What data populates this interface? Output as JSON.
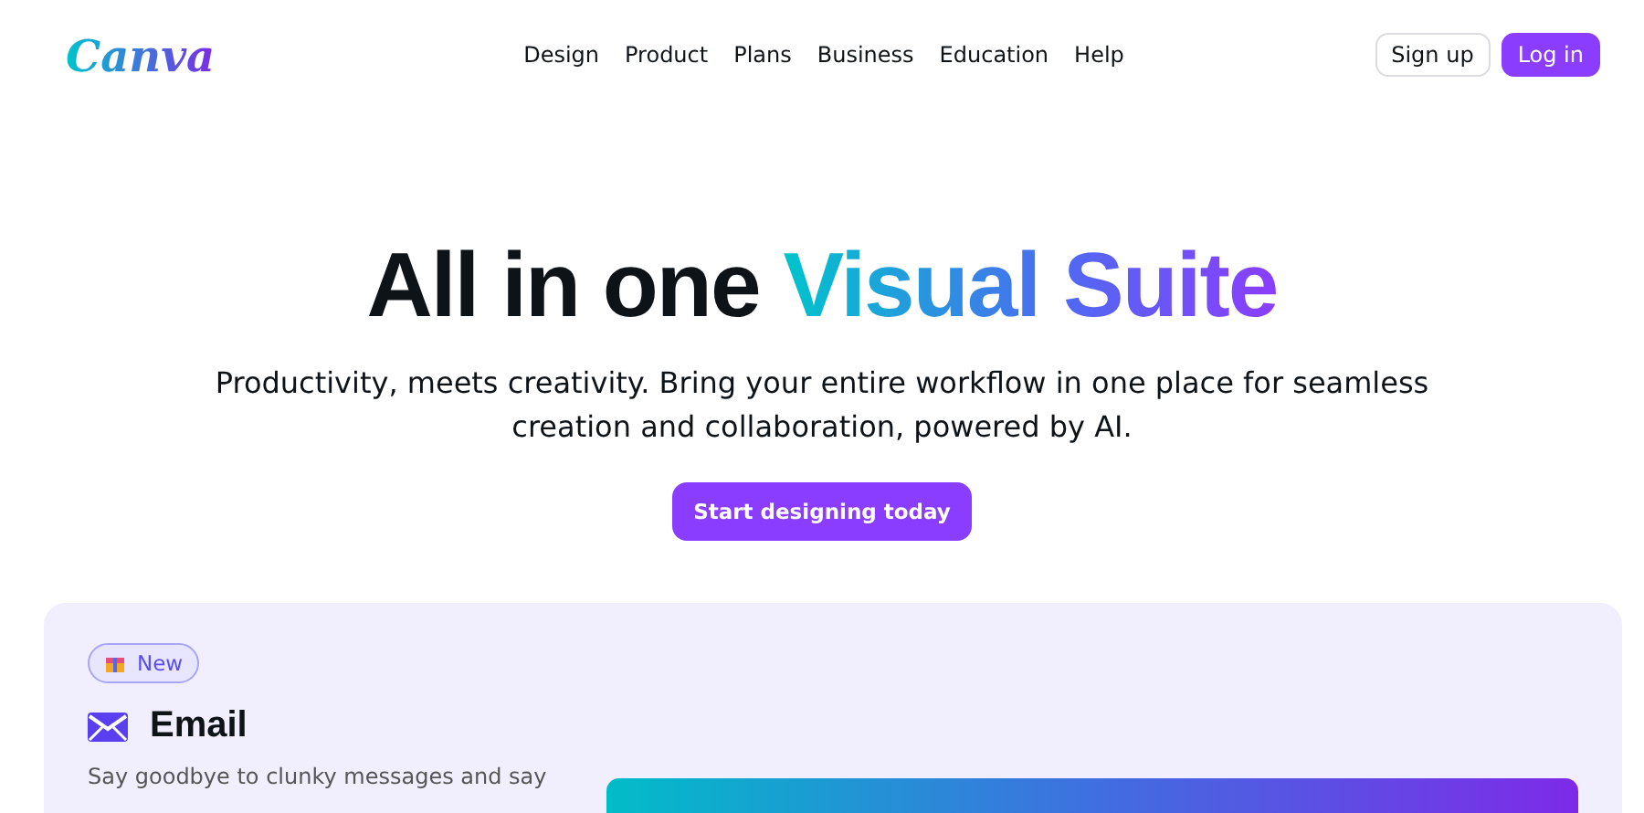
{
  "logo": "Canva",
  "nav": [
    "Design",
    "Product",
    "Plans",
    "Business",
    "Education",
    "Help"
  ],
  "auth": {
    "sign_up": "Sign up",
    "log_in": "Log in"
  },
  "hero": {
    "title_plain": "All in one",
    "title_gradient": "Visual Suite",
    "subtitle": "Productivity, meets creativity. Bring your entire workflow in one place for seamless creation and collaboration, powered by AI.",
    "cta": "Start designing today"
  },
  "feature": {
    "badge": "New",
    "title": "Email",
    "description": "Say goodbye to clunky messages and say"
  }
}
